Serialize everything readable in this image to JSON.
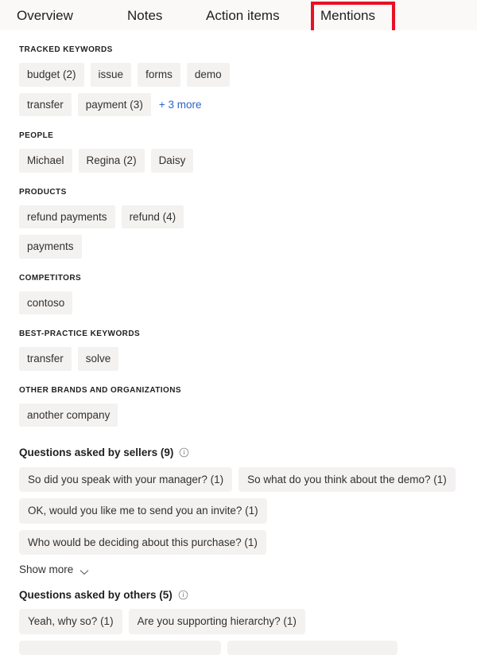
{
  "tabs": [
    {
      "id": "overview",
      "label": "Overview",
      "selected": false
    },
    {
      "id": "notes",
      "label": "Notes",
      "selected": false
    },
    {
      "id": "action-items",
      "label": "Action items",
      "selected": false
    },
    {
      "id": "mentions",
      "label": "Mentions",
      "selected": true
    }
  ],
  "highlight": {
    "target_tab": "Mentions",
    "color": "#e81123"
  },
  "colors": {
    "tabbar_background": "#faf9f8",
    "content_background": "#ffffff",
    "chip_background": "#f3f2f1",
    "chip_text": "#323130",
    "link": "#2b66c4",
    "highlight": "#e81123"
  },
  "sections": [
    {
      "id": "tracked-keywords",
      "label": "TRACKED KEYWORDS",
      "rows": [
        {
          "chips": [
            "budget (2)",
            "issue",
            "forms",
            "demo"
          ]
        },
        {
          "chips": [
            "transfer",
            "payment (3)"
          ],
          "more_link": "+ 3 more"
        }
      ]
    },
    {
      "id": "people",
      "label": "PEOPLE",
      "rows": [
        {
          "chips": [
            "Michael",
            "Regina (2)",
            "Daisy"
          ]
        }
      ]
    },
    {
      "id": "products",
      "label": "PRODUCTS",
      "rows": [
        {
          "chips": [
            "refund payments",
            "refund (4)"
          ]
        },
        {
          "chips": [
            "payments"
          ]
        }
      ]
    },
    {
      "id": "competitors",
      "label": "COMPETITORS",
      "rows": [
        {
          "chips": [
            "contoso"
          ]
        }
      ]
    },
    {
      "id": "best-practice-keywords",
      "label": "BEST-PRACTICE KEYWORDS",
      "rows": [
        {
          "chips": [
            "transfer",
            "solve"
          ]
        }
      ]
    },
    {
      "id": "other-brands",
      "label": "OTHER BRANDS AND ORGANIZATIONS",
      "rows": [
        {
          "chips": [
            "another company"
          ]
        }
      ]
    }
  ],
  "questions_sellers": {
    "heading": "Questions asked by sellers (9)",
    "info_icon": "info-icon",
    "rows": [
      {
        "chips": [
          "So did you speak with your manager? (1)",
          "So what do you think about the demo? (1)"
        ]
      },
      {
        "chips": [
          "OK, would you like me to send you an invite? (1)",
          "Who would be deciding about this purchase? (1)"
        ]
      }
    ],
    "show_more_label": "Show more",
    "show_more_icon": "chevron-down-icon"
  },
  "questions_others": {
    "heading": "Questions asked by others (5)",
    "info_icon": "info-icon",
    "rows": [
      {
        "chips": [
          "Yeah, why so? (1)",
          "Are you supporting hierarchy? (1)"
        ]
      },
      {
        "chips": [
          "",
          ""
        ]
      }
    ]
  }
}
